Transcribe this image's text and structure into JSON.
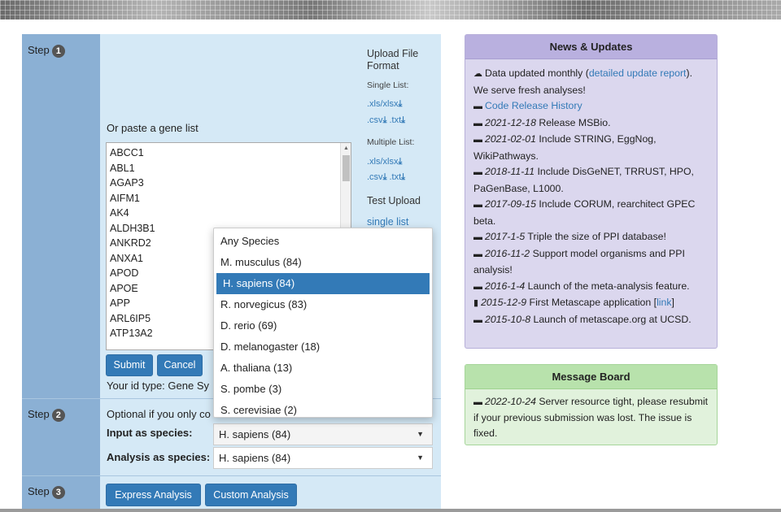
{
  "colors": {
    "accent": "#337ab7",
    "step_panel": "#d5e9f6",
    "news_bg": "#dbd7ee",
    "message_bg": "#e1f2dc"
  },
  "steps": {
    "step_label": "Step",
    "step1_num": "1",
    "step2_num": "2",
    "step3_num": "3"
  },
  "step1": {
    "paste_label": "Or paste a gene list",
    "genes": [
      "ABCC1",
      "ABL1",
      "AGAP3",
      "AIFM1",
      "AK4",
      "ALDH3B1",
      "ANKRD2",
      "ANXA1",
      "APOD",
      "APOE",
      "APP",
      "ARL6IP5",
      "ATP13A2"
    ],
    "submit_label": "Submit",
    "cancel_label": "Cancel",
    "id_type_text": "Your id type: Gene Sy",
    "upload_title": "Upload File Format",
    "single_list_label": "Single List:",
    "single_xls": ".xls/xlsx",
    "single_csv": ".csv",
    "single_txt": ".txt",
    "multiple_list_label": "Multiple List:",
    "multi_xls": ".xls/xlsx",
    "multi_csv": ".csv",
    "multi_txt": ".txt",
    "test_upload_label": "Test Upload",
    "single_list_link": "single list",
    "download_icon": "download-icon"
  },
  "species_dropdown": {
    "options": [
      "Any Species",
      "M. musculus (84)",
      "H. sapiens (84)",
      "R. norvegicus (83)",
      "D. rerio (69)",
      "D. melanogaster (18)",
      "A. thaliana (13)",
      "S. pombe (3)",
      "S. cerevisiae (2)"
    ],
    "selected": "H. sapiens (84)"
  },
  "step2": {
    "optional_text": "Optional if you only co",
    "input_label": "Input as species:",
    "input_value": "H. sapiens (84)",
    "analysis_label": "Analysis as species:",
    "analysis_value": "H. sapiens (84)"
  },
  "step3": {
    "express_label": "Express Analysis",
    "custom_label": "Custom Analysis"
  },
  "news": {
    "title": "News & Updates",
    "intro_pre": "Data updated monthly (",
    "intro_link": "detailed update report",
    "intro_post": "). We serve fresh analyses!",
    "code_release": "Code Release History",
    "items": [
      {
        "date": "2021-12-18",
        "text": " Release MSBio."
      },
      {
        "date": "2021-02-01",
        "text": " Include STRING, EggNog, WikiPathways."
      },
      {
        "date": "2018-11-11",
        "text": " Include DisGeNET, TRRUST, HPO, PaGenBase, L1000."
      },
      {
        "date": "2017-09-15",
        "text": " Include CORUM, rearchitect GPEC beta."
      },
      {
        "date": "2017-1-5",
        "text": " Triple the size of PPI database!"
      },
      {
        "date": "2016-11-2",
        "text": " Support model organisms and PPI analysis!"
      },
      {
        "date": "2016-1-4",
        "text": " Launch of the meta-analysis feature."
      }
    ],
    "app_date": "2015-12-9",
    "app_text": " First Metascape application [",
    "app_link": "link",
    "app_close": "]",
    "launch_date": "2015-10-8",
    "launch_text": " Launch of metascape.org at UCSD."
  },
  "message": {
    "title": "Message Board",
    "date": "2022-10-24",
    "text": " Server resource tight, please resubmit if your previous submission was lost. The issue is fixed."
  }
}
